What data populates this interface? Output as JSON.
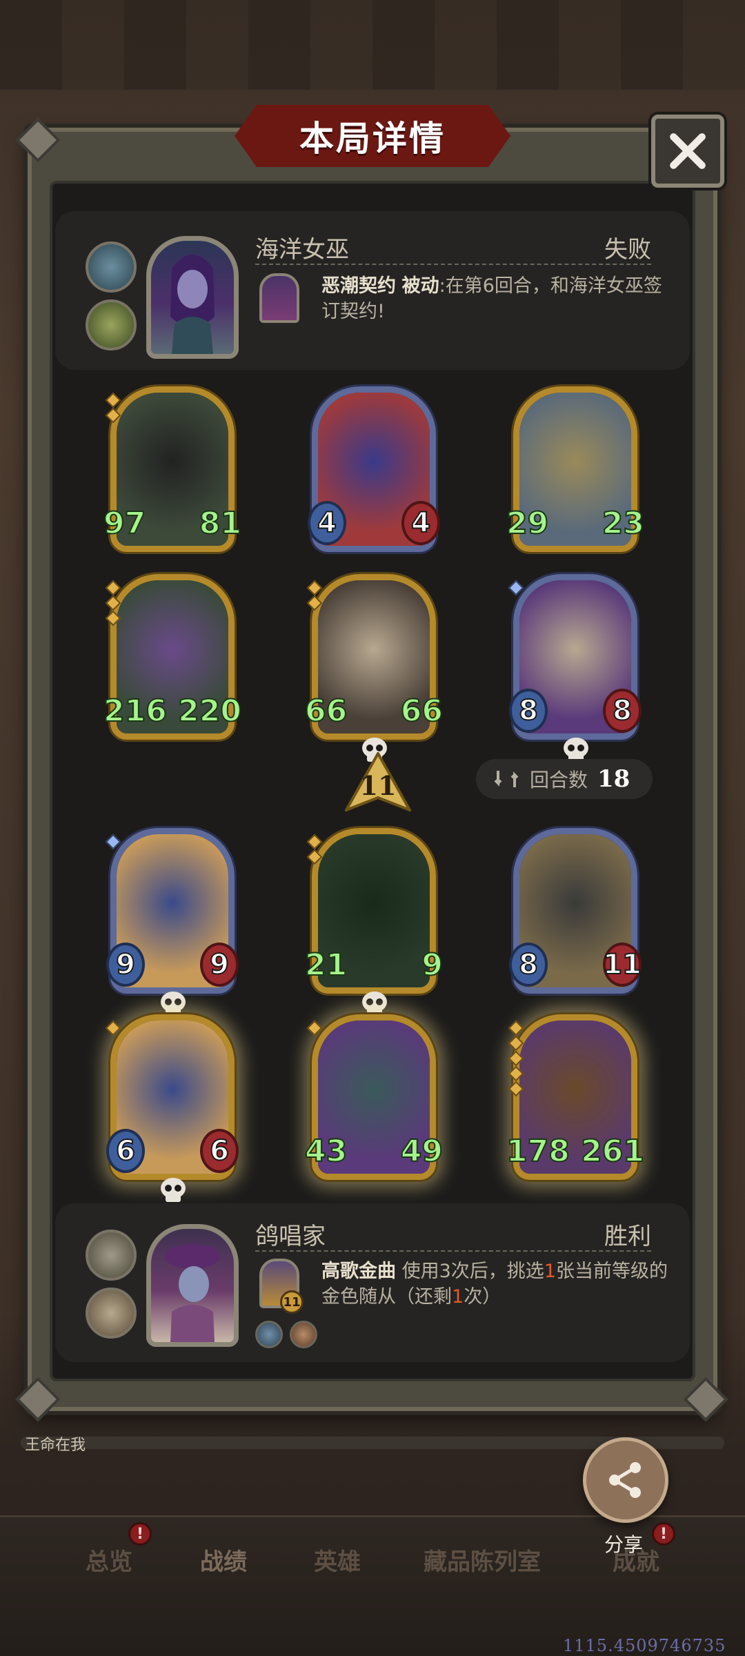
{
  "title": "本局详情",
  "top_player": {
    "name": "海洋女巫",
    "result": "失败",
    "skill_name": "恶潮契约",
    "skill_type": "被动",
    "skill_desc": ":在第6回合，和海洋女巫签订契约!"
  },
  "board": {
    "row1": [
      {
        "atk": "97",
        "hp": "81"
      },
      {
        "atk": "4",
        "hp": "4"
      },
      {
        "atk": "29",
        "hp": "23"
      }
    ],
    "row2": [
      {
        "atk": "216",
        "hp": "220"
      },
      {
        "atk": "66",
        "hp": "66"
      },
      {
        "atk": "8",
        "hp": "8"
      }
    ],
    "row3": [
      {
        "atk": "9",
        "hp": "9"
      },
      {
        "atk": "21",
        "hp": "9"
      },
      {
        "atk": "8",
        "hp": "11"
      }
    ],
    "row4": [
      {
        "atk": "6",
        "hp": "6"
      },
      {
        "atk": "43",
        "hp": "49"
      },
      {
        "atk": "178",
        "hp": "261"
      }
    ]
  },
  "tier": "11",
  "rounds": {
    "label": "回合数",
    "value": "18"
  },
  "bottom_player": {
    "name": "鸽唱家",
    "result": "胜利",
    "skill_name": "高歌金曲",
    "skill_desc_a": " 使用3次后，挑选",
    "skill_desc_num": "1",
    "skill_desc_b": "张当前等级的金色随从（还剩",
    "skill_desc_remaining": "1",
    "skill_desc_c": "次）",
    "skill_level": "11"
  },
  "strip_text": "王命在我",
  "nav": {
    "items": [
      "总览",
      "战绩",
      "英雄",
      "藏品陈列室",
      "成就"
    ],
    "active": "战绩"
  },
  "share_label": "分享",
  "watermark": "1115.4509746735",
  "icons": {
    "close": "close-icon",
    "share": "share-icon",
    "refresh": "refresh-icon",
    "skull": "skull-icon",
    "badge": "exclamation-icon"
  }
}
